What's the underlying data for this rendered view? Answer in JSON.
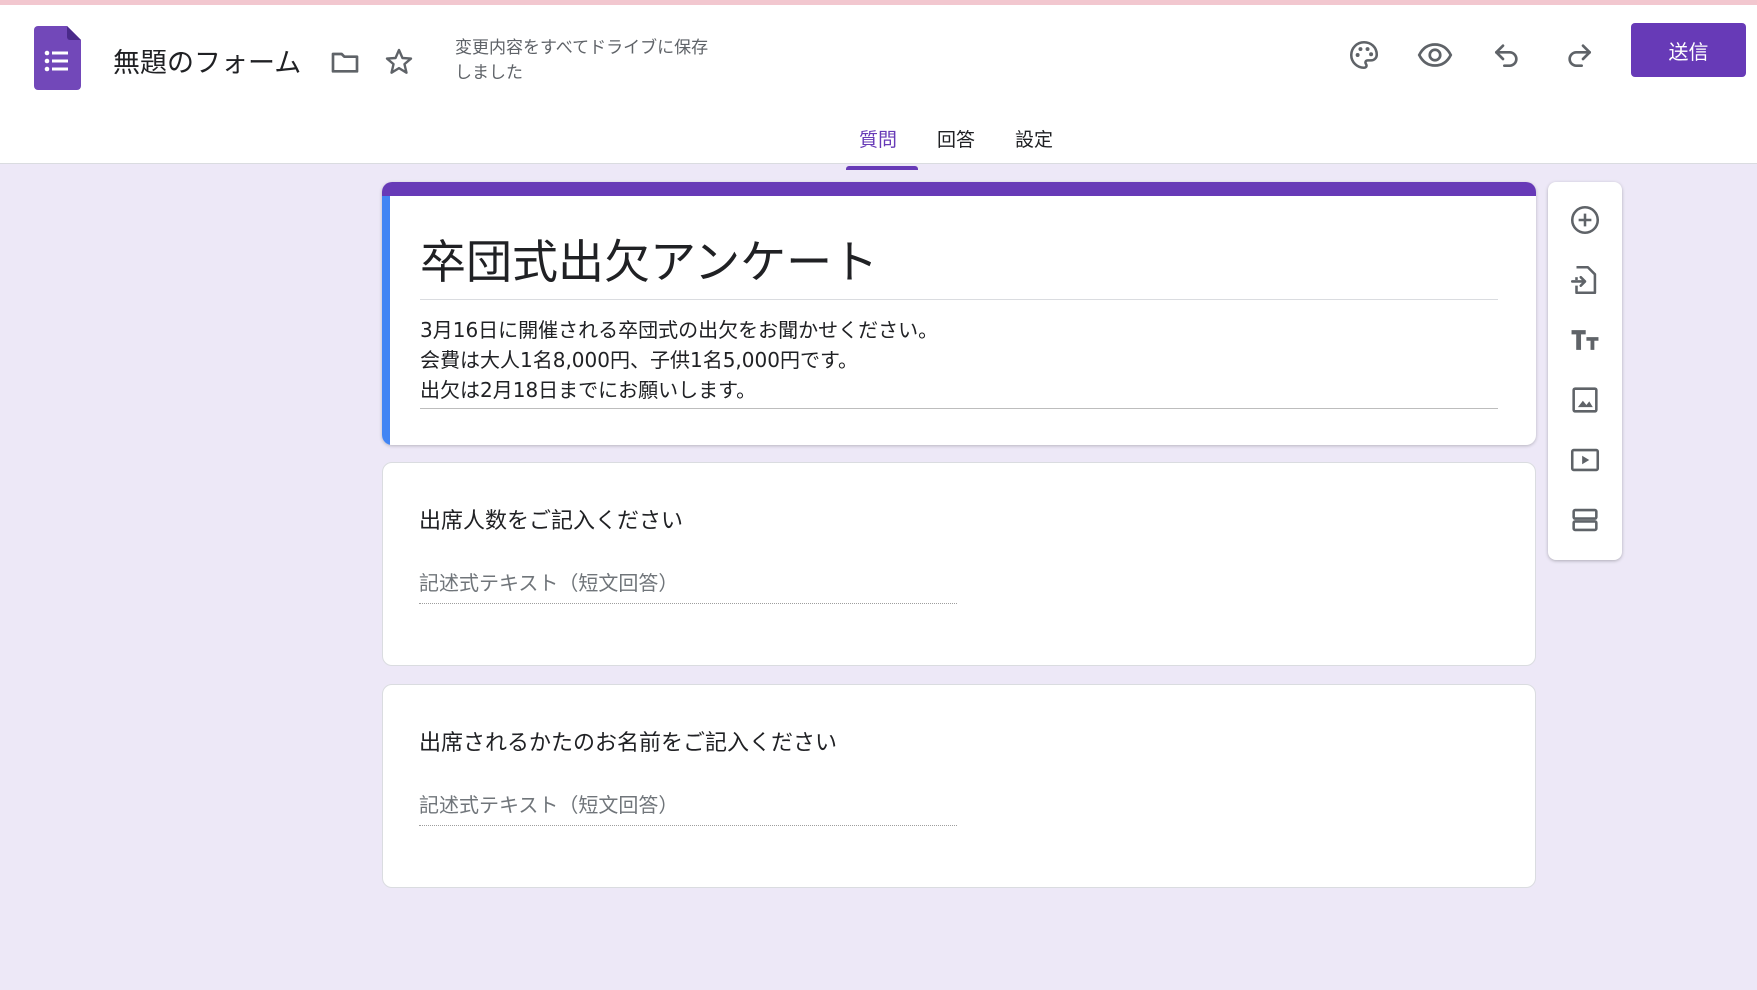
{
  "app": {
    "doc_title": "無題のフォーム",
    "save_status": "変更内容をすべてドライブに保存しました",
    "send_label": "送信",
    "accent_color": "#673ab7",
    "icons": [
      "forms-logo-icon",
      "folder-icon",
      "star-icon",
      "palette-icon",
      "eye-icon",
      "undo-icon",
      "redo-icon"
    ]
  },
  "tabs": [
    {
      "label": "質問",
      "active": true
    },
    {
      "label": "回答",
      "active": false
    },
    {
      "label": "設定",
      "active": false
    }
  ],
  "form": {
    "title": "卒団式出欠アンケート",
    "description_lines": [
      "3月16日に開催される卒団式の出欠をお聞かせください。",
      "会費は大人1名8,000円、子供1名5,000円です。",
      "出欠は2月18日までにお願いします。"
    ]
  },
  "questions": [
    {
      "title": "出席人数をご記入ください",
      "answer_placeholder": "記述式テキスト（短文回答）"
    },
    {
      "title": "出席されるかたのお名前をご記入ください",
      "answer_placeholder": "記述式テキスト（短文回答）"
    }
  ],
  "tools": [
    "add-question-icon",
    "import-questions-icon",
    "add-title-icon",
    "add-image-icon",
    "add-video-icon",
    "add-section-icon"
  ]
}
